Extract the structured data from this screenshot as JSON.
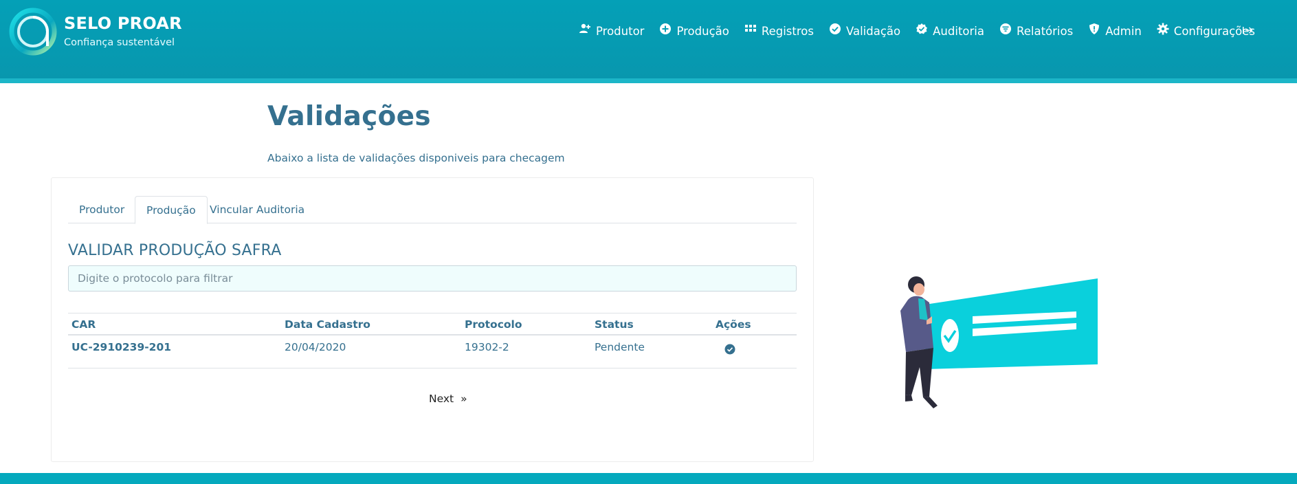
{
  "brand": {
    "title": "SELO PROAR",
    "subtitle": "Confiança sustentável"
  },
  "nav": [
    {
      "label": "Produtor",
      "icon": "user-plus-icon"
    },
    {
      "label": "Produção",
      "icon": "plus-circle-icon"
    },
    {
      "label": "Registros",
      "icon": "grid-icon"
    },
    {
      "label": "Validação",
      "icon": "check-circle-icon"
    },
    {
      "label": "Auditoria",
      "icon": "badge-check-icon"
    },
    {
      "label": "Relatórios",
      "icon": "filter-circle-icon"
    },
    {
      "label": "Admin",
      "icon": "shield-icon"
    },
    {
      "label": "Configurações",
      "icon": "gear-icon"
    }
  ],
  "page": {
    "title": "Validações",
    "subtitle": "Abaixo a lista de validações disponiveis para checagem"
  },
  "tabs": [
    {
      "label": "Produtor",
      "active": false
    },
    {
      "label": "Produção",
      "active": true
    },
    {
      "label": "Vincular Auditoria",
      "active": false
    }
  ],
  "section": {
    "title": "VALIDAR PRODUÇÃO SAFRA",
    "filter_placeholder": "Digite o protocolo para filtrar",
    "filter_value": ""
  },
  "table": {
    "columns": [
      "CAR",
      "Data Cadastro",
      "Protocolo",
      "Status",
      "Ações"
    ],
    "rows": [
      {
        "car": "UC-2910239-201",
        "data": "20/04/2020",
        "protocolo": "19302-2",
        "status": "Pendente",
        "action_icon": "check-circle-icon"
      }
    ]
  },
  "pager": {
    "label": "Next",
    "arrows": "»"
  },
  "colors": {
    "header": "#04a0b7",
    "accent": "#35708f",
    "illustration": "#0ad0dc"
  }
}
